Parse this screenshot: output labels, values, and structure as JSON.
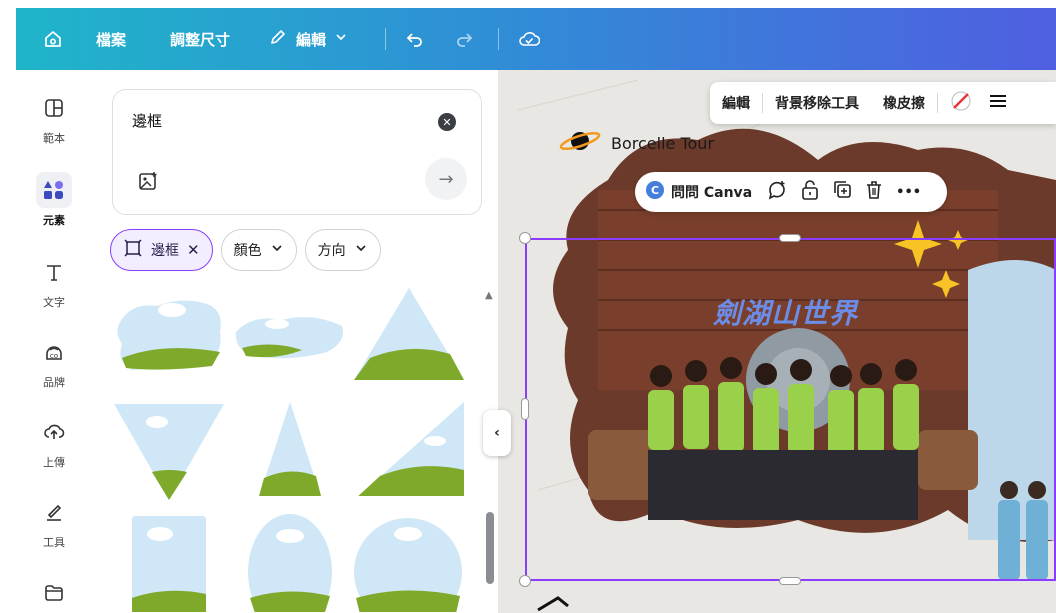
{
  "topbar": {
    "file_label": "檔案",
    "resize_label": "調整尺寸",
    "edit_label": "編輯"
  },
  "sidebar": {
    "items": [
      {
        "label": "範本",
        "icon": "template-icon"
      },
      {
        "label": "元素",
        "icon": "elements-icon",
        "active": true
      },
      {
        "label": "文字",
        "icon": "text-icon"
      },
      {
        "label": "品牌",
        "icon": "brand-icon"
      },
      {
        "label": "上傳",
        "icon": "upload-icon"
      },
      {
        "label": "工具",
        "icon": "tools-icon"
      },
      {
        "label": "",
        "icon": "folder-icon"
      }
    ]
  },
  "search": {
    "value": "邊框"
  },
  "filters": {
    "chips": [
      {
        "label": "邊框",
        "active": true
      },
      {
        "label": "顏色"
      },
      {
        "label": "方向"
      }
    ]
  },
  "context_toolbar": {
    "edit_label": "編輯",
    "bg_remover_label": "背景移除工具",
    "eraser_label": "橡皮擦"
  },
  "canvas": {
    "brand_text": "Borcelle Tour",
    "sign_text": "劍湖山世界"
  },
  "floating_toolbar": {
    "ask_canva_label": "問問 Canva",
    "more_label": "•••"
  },
  "colors": {
    "accent": "#8b3dff",
    "topbar_start": "#1fb5c9",
    "topbar_end": "#4f5fe0",
    "sky": "#cfe7f7",
    "grass": "#7fa92a"
  }
}
